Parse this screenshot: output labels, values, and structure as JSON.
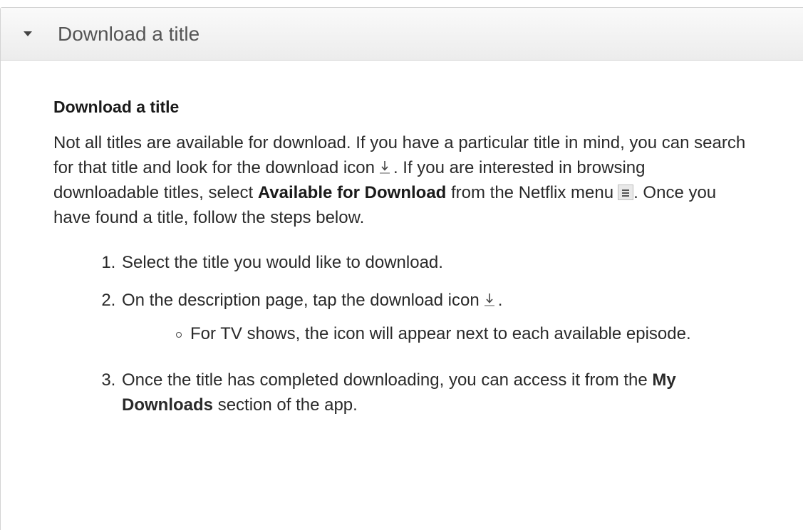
{
  "accordion": {
    "header_title": "Download a title",
    "caret_icon": "caret-down-icon"
  },
  "content": {
    "title": "Download a title",
    "intro": {
      "part1": "Not all titles are available for download. If you have a particular title in mind, you can search for that title and look for the download icon",
      "part2": ". If you are interested in browsing downloadable titles, select",
      "bold1": "Available for Download",
      "part3": "from the Netflix menu",
      "part4": ". Once you have found a title, follow the steps below."
    },
    "steps": [
      {
        "text": "Select the title you would like to download."
      },
      {
        "text": "On the description page, tap the download icon",
        "suffix": ".",
        "sub": [
          "For TV shows, the icon will appear next to each available episode."
        ]
      },
      {
        "text_before": "Once the title has completed downloading, you can access it from the",
        "bold": "My Downloads",
        "text_after": "section of the app."
      }
    ]
  },
  "icons": {
    "download": "download-icon",
    "menu": "menu-icon"
  },
  "colors": {
    "text": "#2a2a2a",
    "header_bg": "#f2f2f2",
    "border": "#d3d3d3"
  }
}
